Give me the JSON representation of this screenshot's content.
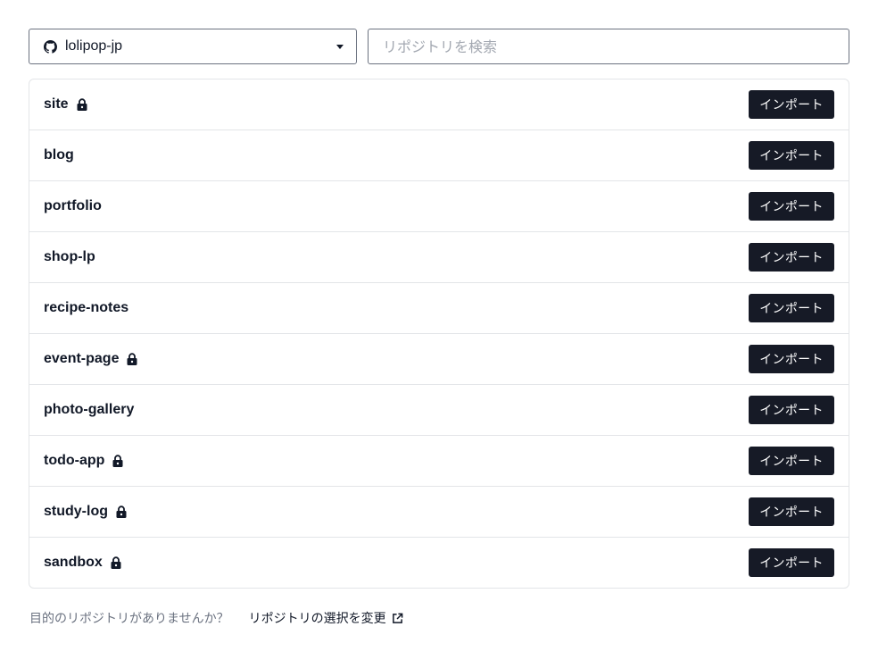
{
  "account_select": {
    "value": "lolipop-jp",
    "icon": "github-icon"
  },
  "search": {
    "placeholder": "リポジトリを検索",
    "value": ""
  },
  "repositories": [
    {
      "name": "site",
      "private": true,
      "action_label": "インポート"
    },
    {
      "name": "blog",
      "private": false,
      "action_label": "インポート"
    },
    {
      "name": "portfolio",
      "private": false,
      "action_label": "インポート"
    },
    {
      "name": "shop-lp",
      "private": false,
      "action_label": "インポート"
    },
    {
      "name": "recipe-notes",
      "private": false,
      "action_label": "インポート"
    },
    {
      "name": "event-page",
      "private": true,
      "action_label": "インポート"
    },
    {
      "name": "photo-gallery",
      "private": false,
      "action_label": "インポート"
    },
    {
      "name": "todo-app",
      "private": true,
      "action_label": "インポート"
    },
    {
      "name": "study-log",
      "private": true,
      "action_label": "インポート"
    },
    {
      "name": "sandbox",
      "private": true,
      "action_label": "インポート"
    }
  ],
  "footer": {
    "hint": "目的のリポジトリがありませんか？",
    "link_label": "リポジトリの選択を変更",
    "link_icon": "external-link-icon"
  },
  "colors": {
    "button_bg": "#161a26",
    "button_text": "#ffffff",
    "border": "#e3e5e8"
  }
}
